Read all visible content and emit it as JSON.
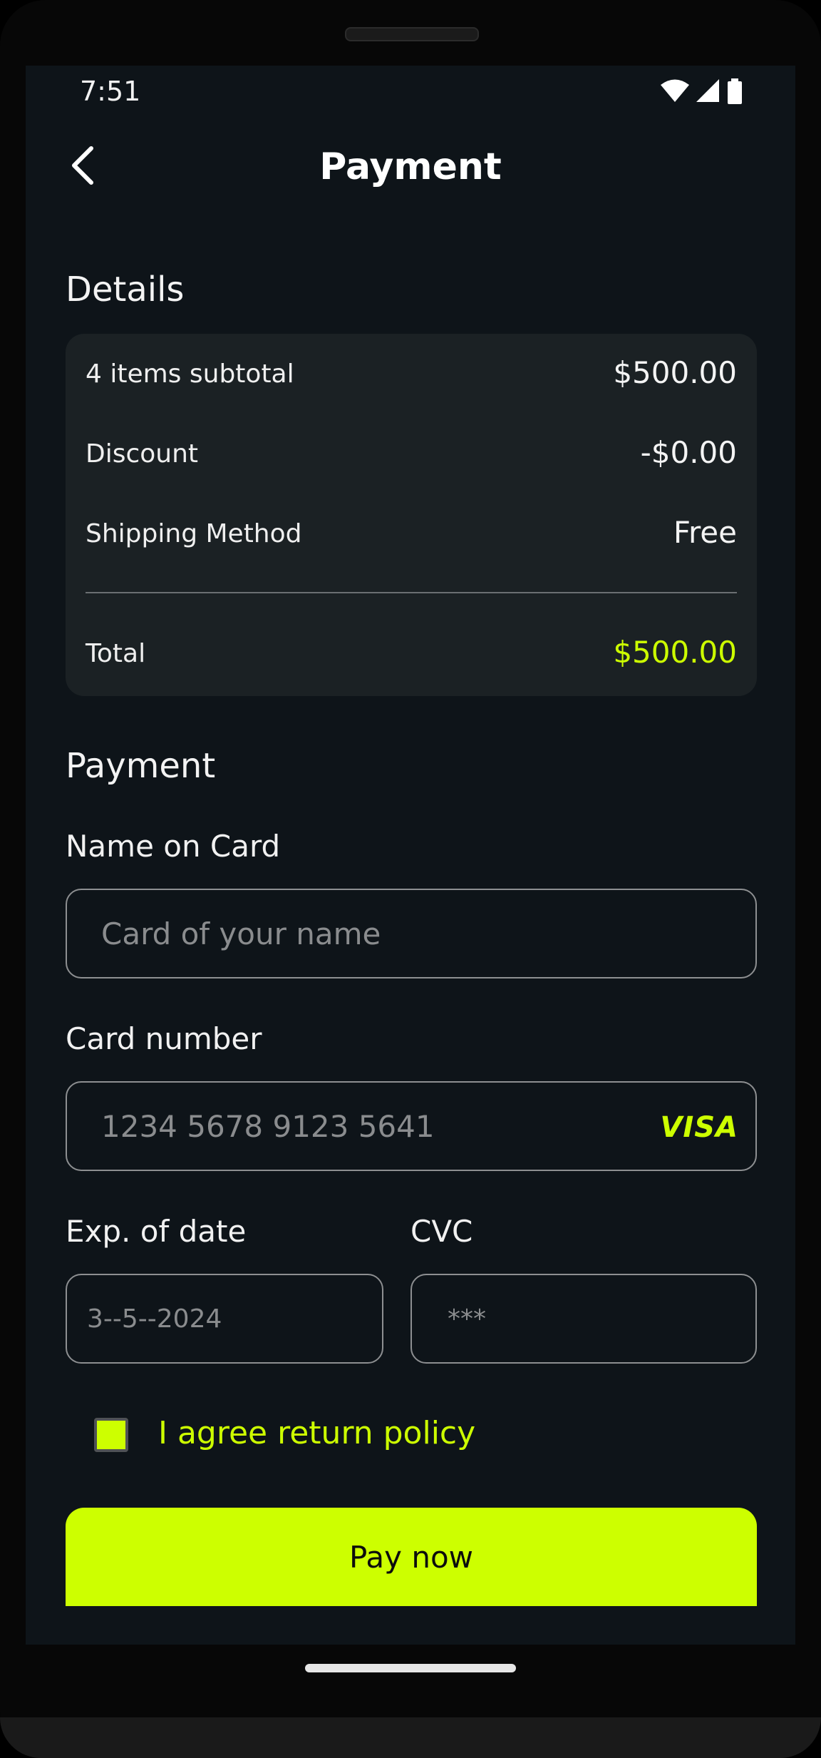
{
  "status_bar": {
    "time": "7:51"
  },
  "header": {
    "title": "Payment",
    "back_icon": "chevron-left-icon"
  },
  "details": {
    "title": "Details",
    "rows": [
      {
        "label": "4 items subtotal",
        "value": "$500.00"
      },
      {
        "label": "Discount",
        "value": "-$0.00"
      },
      {
        "label": "Shipping Method",
        "value": "Free"
      }
    ],
    "total": {
      "label": "Total",
      "value": "$500.00"
    }
  },
  "payment": {
    "title": "Payment",
    "name_on_card": {
      "label": "Name on Card",
      "placeholder": "Card of your name"
    },
    "card_number": {
      "label": "Card number",
      "placeholder": "1234 5678 9123 5641",
      "brand": "VISA"
    },
    "exp_date": {
      "label": "Exp. of date",
      "placeholder": "3--5--2024"
    },
    "cvc": {
      "label": "CVC",
      "placeholder": "***"
    },
    "agree": {
      "label": "I agree return policy",
      "checked": true
    },
    "pay_button": "Pay now"
  },
  "colors": {
    "accent": "#cdff00",
    "background": "#0e1419",
    "card": "#1b2124"
  }
}
